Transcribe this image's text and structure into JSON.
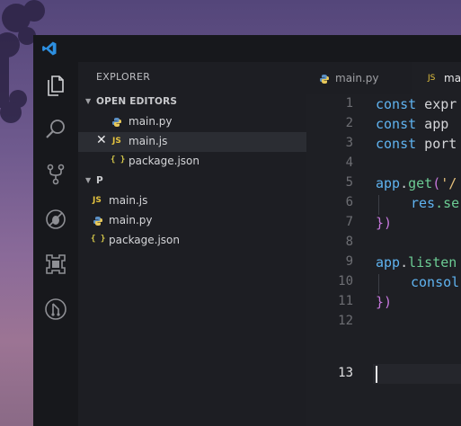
{
  "sidebar": {
    "title": "EXPLORER",
    "open_editors_header": "OPEN EDITORS",
    "open_editors": [
      {
        "label": "main.py",
        "icon": "python-icon"
      },
      {
        "label": "main.js",
        "icon": "js-icon"
      },
      {
        "label": "package.json",
        "icon": "json-icon"
      }
    ],
    "folder_header": "P",
    "files": [
      {
        "label": "main.js",
        "icon": "js-icon"
      },
      {
        "label": "main.py",
        "icon": "python-icon"
      },
      {
        "label": "package.json",
        "icon": "json-icon"
      }
    ],
    "js_glyph": "JS",
    "json_glyph": "{ }",
    "close_glyph": "✕"
  },
  "tabs": [
    {
      "label": "main.py",
      "icon": "python-icon",
      "active": false
    },
    {
      "label": "mai",
      "icon": "js-icon",
      "active": true
    }
  ],
  "editor": {
    "line_numbers": [
      "1",
      "2",
      "3",
      "4",
      "5",
      "6",
      "7",
      "8",
      "9",
      "10",
      "11",
      "12",
      "13"
    ],
    "current_line": "13",
    "lines": {
      "l1_kw": "const",
      "l1_rest": " expr",
      "l2_kw": "const",
      "l2_rest": " app",
      "l3_kw": "const",
      "l3_rest": " port",
      "l5_obj": "app",
      "l5_dot": ".",
      "l5_fn": "get",
      "l5_paren": "(",
      "l5_str": "'/",
      "l6_obj": "res",
      "l6_rest": ".se",
      "l7_brace": "})",
      "l9_obj": "app",
      "l9_dot": ".",
      "l9_fn": "listen",
      "l10_rest": "consol",
      "l11_brace": "})"
    }
  },
  "colors": {
    "accent": "#2d8fe0",
    "keyword": "#5fb3f0",
    "function": "#6ccc94",
    "string": "#e6c07b",
    "brace": "#c678dd"
  }
}
